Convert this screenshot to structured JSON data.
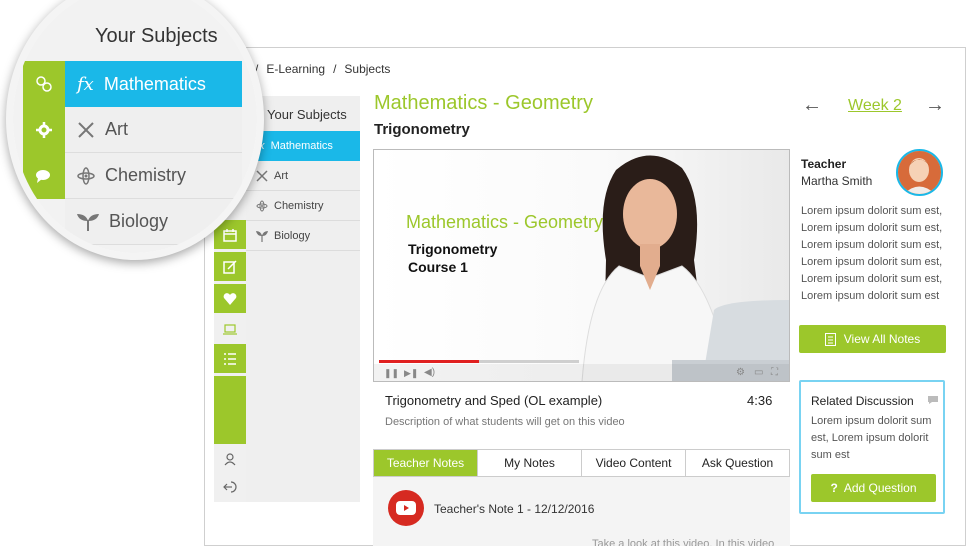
{
  "breadcrumb": {
    "sep1": "/",
    "item1": "E-Learning",
    "sep2": "/",
    "item2": "Subjects"
  },
  "subjects": {
    "title": "Your Subjects",
    "items": [
      {
        "label": "Mathematics",
        "icon": "function-icon"
      },
      {
        "label": "Art",
        "icon": "brush-icon"
      },
      {
        "label": "Chemistry",
        "icon": "atom-icon"
      },
      {
        "label": "Biology",
        "icon": "sprout-icon"
      }
    ]
  },
  "main": {
    "title": "Mathematics - Geometry",
    "subtitle": "Trigonometry"
  },
  "video": {
    "overlay_title": "Mathematics - Geometry",
    "overlay_line1": "Trigonometry",
    "overlay_line2": "Course 1",
    "progress": 0.5,
    "name": "Trigonometry and Sped (OL example)",
    "duration": "4:36",
    "description": "Description of what students will get on this video"
  },
  "tabs": [
    "Teacher Notes",
    "My Notes",
    "Video Content",
    "Ask Question"
  ],
  "note": {
    "title": "Teacher's Note 1 - 12/12/2016",
    "extra": "Take a look at this video. In this video"
  },
  "week": {
    "prev": "←",
    "label": "Week 2",
    "next": "→"
  },
  "teacher": {
    "label": "Teacher",
    "name": "Martha Smith",
    "description": "Lorem ipsum dolorit sum est, Lorem ipsum dolorit sum est, Lorem ipsum dolorit sum est, Lorem ipsum dolorit sum est, Lorem ipsum dolorit sum est, Lorem ipsum dolorit sum est"
  },
  "buttons": {
    "view_notes": "View All Notes",
    "add_question": "Add Question",
    "add_question_icon": "?"
  },
  "related": {
    "title": "Related Discussion",
    "text": "Lorem ipsum dolorit sum est, Lorem ipsum dolorit sum est"
  },
  "colors": {
    "green": "#9cc72b",
    "blue": "#1ab8e8",
    "red": "#d62a21"
  }
}
